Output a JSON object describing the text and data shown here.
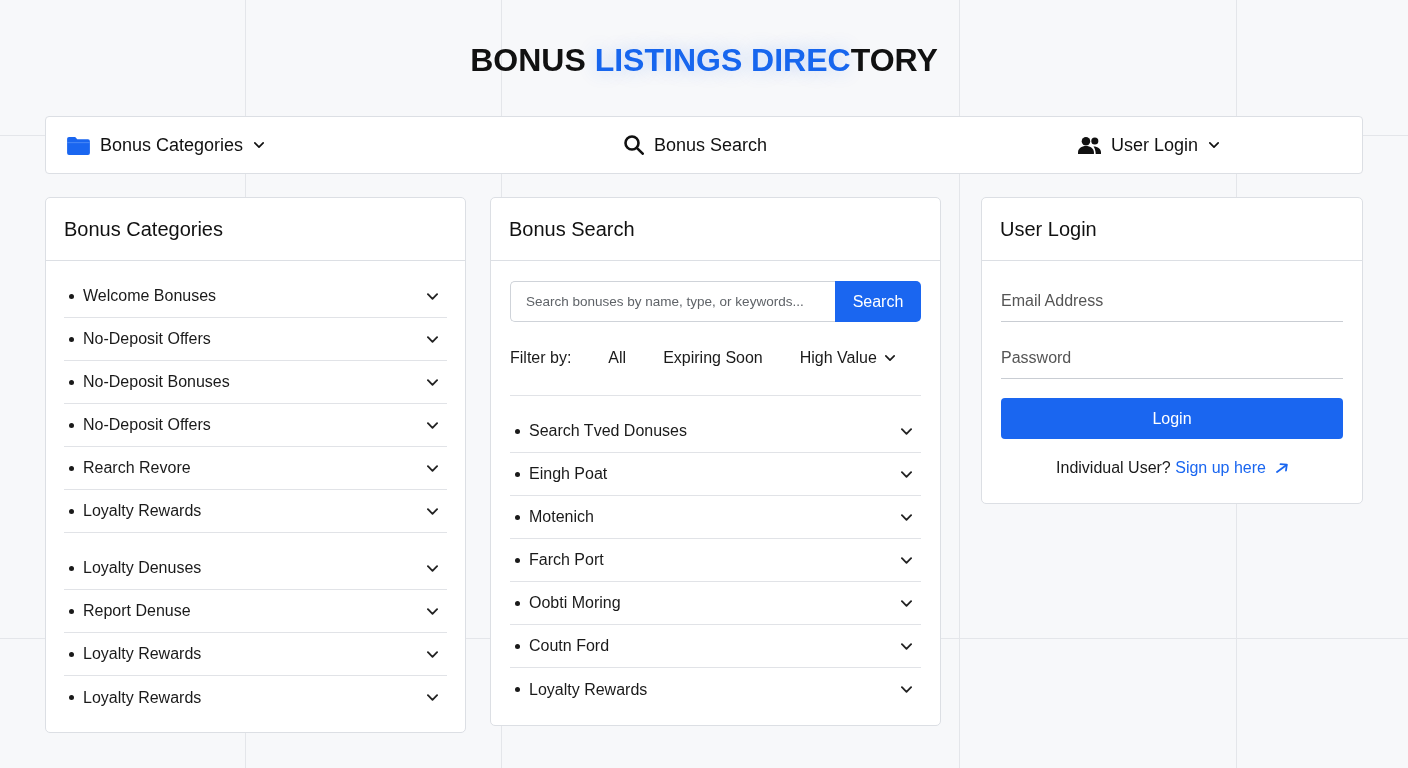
{
  "title": {
    "parts": [
      {
        "text": "BONUS ",
        "highlighted": false
      },
      {
        "text": "LISTINGS DIREC",
        "highlighted": true
      },
      {
        "text": "TORY",
        "highlighted": false
      }
    ]
  },
  "nav": {
    "items": [
      {
        "label": "Bonus Categories",
        "has_menu": true
      },
      {
        "label": "Bonus Search",
        "has_menu": false
      },
      {
        "label": "User Login",
        "has_menu": true
      }
    ]
  },
  "categories_panel": {
    "title": "Bonus Categories",
    "groups": [
      {
        "items": [
          {
            "label": "Welcome Bonuses",
            "expanded": false
          },
          {
            "label": "No-Deposit Offers",
            "expanded": false
          },
          {
            "label": "No-Deposit Bonuses",
            "expanded": false
          },
          {
            "label": "No-Deposit Offers",
            "expanded": false
          },
          {
            "label": "Rearch Revore",
            "expanded": false
          },
          {
            "label": "Loyalty Rewards",
            "expanded": false
          }
        ]
      },
      {
        "items": [
          {
            "label": "Loyalty Denuses",
            "expanded": false
          },
          {
            "label": "Report Denuse",
            "expanded": false
          },
          {
            "label": "Loyalty Rewards",
            "expanded": false
          },
          {
            "label": "Loyalty Rewards",
            "expanded": false
          }
        ]
      }
    ]
  },
  "search_panel": {
    "title": "Bonus Search",
    "search": {
      "placeholder": "Search bonuses by name, type, or keywords...",
      "button": "Search"
    },
    "filter": {
      "label": "Filter by:",
      "options": [
        {
          "label": "All",
          "selected": false,
          "has_menu": false
        },
        {
          "label": "Expiring Soon",
          "selected": false,
          "has_menu": false
        },
        {
          "label": "High Value",
          "selected": false,
          "has_menu": true
        }
      ]
    },
    "results": [
      {
        "label": "Search Tved Donuses",
        "expanded": false
      },
      {
        "label": "Eingh Poat",
        "expanded": false
      },
      {
        "label": "Motenich",
        "expanded": false
      },
      {
        "label": "Farch Port",
        "expanded": false
      },
      {
        "label": "Oobti Moring",
        "expanded": false
      },
      {
        "label": "Coutn Ford",
        "expanded": false
      },
      {
        "label": "Loyalty Rewards",
        "expanded": false
      }
    ]
  },
  "login_panel": {
    "title": "User Login",
    "fields": [
      {
        "placeholder": "Email Address"
      },
      {
        "placeholder": "Password"
      }
    ],
    "button": "Login",
    "signup": {
      "prompt": "Individual User?",
      "link": "Sign up here"
    }
  }
}
